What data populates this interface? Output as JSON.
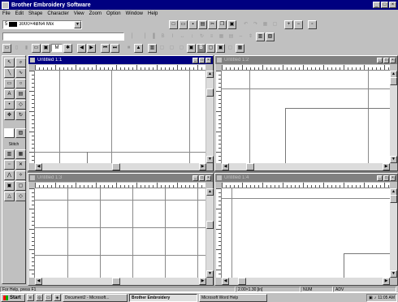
{
  "window": {
    "title": "Brother Embroidery Software"
  },
  "menu": [
    "File",
    "Edit",
    "Shape",
    "Character",
    "View",
    "Zoom",
    "Option",
    "Window",
    "Help"
  ],
  "toolbar1": {
    "size_value": "3000×4BN4 Mix",
    "buttons_a": [
      "new",
      "open",
      "save",
      "print",
      "cut",
      "copy",
      "paste"
    ],
    "buttons_b": [
      "undo",
      "redo",
      "grid",
      "select"
    ],
    "buttons_c": [
      "zoom-in",
      "zoom-out"
    ]
  },
  "toolbar3": {
    "stitch_field": "M",
    "buttons": [
      "prev",
      "next",
      "first",
      "last",
      "stop",
      "run",
      "step"
    ]
  },
  "palette": {
    "label": "Stitch",
    "top_tools": [
      "select",
      "zoom",
      "line",
      "curve",
      "rect",
      "ellipse",
      "text",
      "fill",
      "point",
      "node"
    ],
    "bottom_tools": [
      "satin",
      "fill",
      "run",
      "cross",
      "zig",
      "motif",
      "stamp",
      "outline"
    ]
  },
  "children": [
    {
      "title": "Untitled 1:1",
      "active": true
    },
    {
      "title": "Untitled 1:2",
      "active": false
    },
    {
      "title": "Untitled 1:3",
      "active": false
    },
    {
      "title": "Untitled 1:4",
      "active": false
    }
  ],
  "status": {
    "help": "For Help, press F1",
    "dims": "2.00×1.30 [in]",
    "mode": "NUM",
    "extra": "ADV"
  },
  "taskbar": {
    "start": "Start",
    "tasks": [
      "Document2 - Microsoft...",
      "Brother Embroidery",
      "Microsoft Word Help"
    ],
    "clock": "11:05 AM"
  }
}
